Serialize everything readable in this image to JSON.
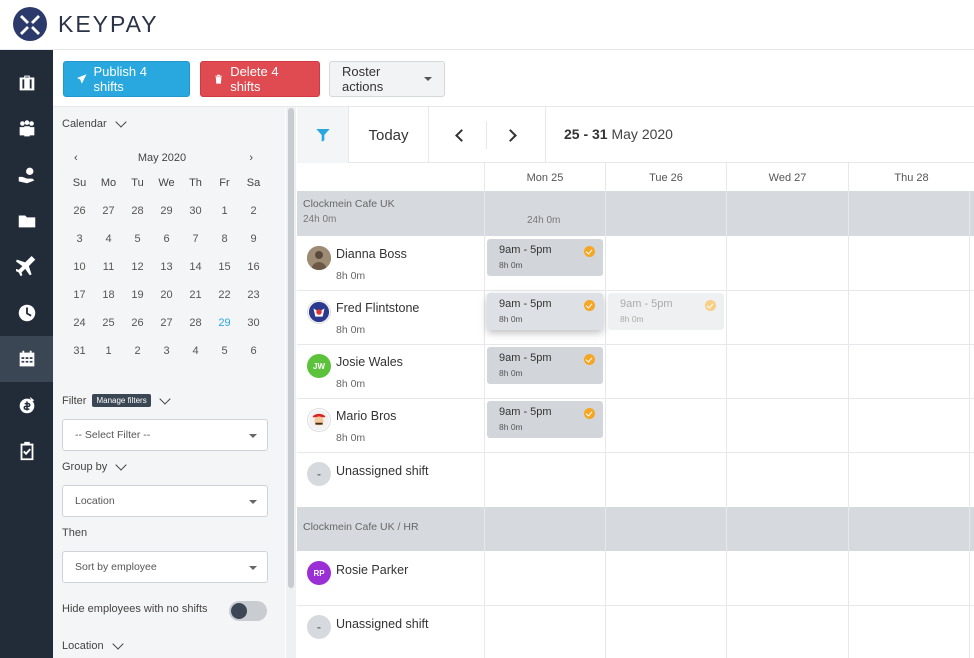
{
  "brand": {
    "name": "KEYPAY"
  },
  "sidenav": {
    "items": [
      {
        "icon": "briefcase-icon"
      },
      {
        "icon": "people-icon"
      },
      {
        "icon": "hand-coin-icon"
      },
      {
        "icon": "folder-icon"
      },
      {
        "icon": "plane-icon"
      },
      {
        "icon": "clock-icon"
      },
      {
        "icon": "calendar-icon",
        "active": true
      },
      {
        "icon": "money-bag-icon"
      },
      {
        "icon": "clipboard-check-icon"
      }
    ]
  },
  "toolbar": {
    "publish_label": "Publish 4 shifts",
    "delete_label": "Delete 4 shifts",
    "roster_label": "Roster actions"
  },
  "panel": {
    "calendar_label": "Calendar",
    "month_label": "May 2020",
    "weekdays": [
      "Su",
      "Mo",
      "Tu",
      "We",
      "Th",
      "Fr",
      "Sa"
    ],
    "days": [
      "26",
      "27",
      "28",
      "29",
      "30",
      "1",
      "2",
      "3",
      "4",
      "5",
      "6",
      "7",
      "8",
      "9",
      "10",
      "11",
      "12",
      "13",
      "14",
      "15",
      "16",
      "17",
      "18",
      "19",
      "20",
      "21",
      "22",
      "23",
      "24",
      "25",
      "26",
      "27",
      "28",
      "29",
      "30",
      "31",
      "1",
      "2",
      "3",
      "4",
      "5",
      "6"
    ],
    "today_index": 33,
    "filter_label": "Filter",
    "manage_filters": "Manage filters",
    "filter_placeholder": "-- Select Filter --",
    "group_by_label": "Group by",
    "group_by_value": "Location",
    "then_label": "Then",
    "then_value": "Sort by employee",
    "hide_label": "Hide employees with no shifts",
    "location_label": "Location"
  },
  "schedule": {
    "today_label": "Today",
    "range_bold": "25 - 31",
    "range_rest": "May 2020",
    "days": [
      "Mon 25",
      "Tue 26",
      "Wed 27",
      "Thu 28"
    ],
    "groups": [
      {
        "name": "Clockmein Cafe UK",
        "sub": "24h 0m",
        "total": "24h 0m"
      },
      {
        "name": "Clockmein Cafe UK / HR"
      }
    ],
    "employees": [
      {
        "name": "Dianna Boss",
        "hours": "8h 0m"
      },
      {
        "name": "Fred Flintstone",
        "hours": "8h 0m"
      },
      {
        "name": "Josie Wales",
        "hours": "8h 0m",
        "initials": "JW",
        "color": "#5cc13b"
      },
      {
        "name": "Mario Bros",
        "hours": "8h 0m"
      },
      {
        "name": "Unassigned shift",
        "initials": "-"
      },
      {
        "name": "Rosie Parker",
        "initials": "RP",
        "color": "#9b2fd6"
      },
      {
        "name": "Unassigned shift",
        "initials": "-"
      }
    ],
    "shifts": [
      {
        "time": "9am - 5pm",
        "hours": "8h 0m"
      },
      {
        "time": "9am - 5pm",
        "hours": "8h 0m"
      },
      {
        "time": "9am - 5pm",
        "hours": "8h 0m"
      },
      {
        "time": "9am - 5pm",
        "hours": "8h 0m"
      },
      {
        "time": "9am - 5pm",
        "hours": "8h 0m"
      }
    ]
  },
  "colors": {
    "sidebar": "#222c39",
    "publish": "#29a8df",
    "delete": "#e04b52",
    "badge": "#f5a623"
  }
}
